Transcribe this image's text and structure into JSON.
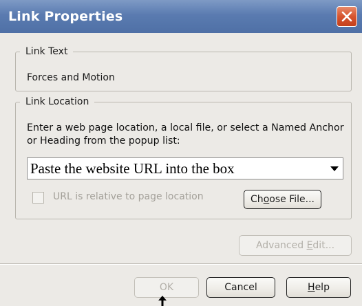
{
  "window": {
    "title": "Link Properties"
  },
  "link_text_group": {
    "legend": "Link Text",
    "value": "Forces and Motion"
  },
  "link_location_group": {
    "legend": "Link Location",
    "instructions": "Enter a web page location, a local file, or select a Named Anchor or Heading from the popup list:",
    "url_value": "Paste the website URL into the box",
    "relative_checkbox_label": "URL is relative to page location",
    "relative_checked": false,
    "choose_file": {
      "pre": "Ch",
      "accel": "o",
      "post": "ose File..."
    }
  },
  "advanced_edit": {
    "pre": "Advanced ",
    "accel": "E",
    "post": "dit..."
  },
  "buttons": {
    "ok": "OK",
    "cancel": "Cancel",
    "help": {
      "accel": "H",
      "post": "elp"
    }
  },
  "colors": {
    "titlebar": "#5a7bb0",
    "close": "#d6542f",
    "dialog_bg": "#eceae6"
  },
  "icons": {
    "close": "close-icon",
    "dropdown": "chevron-down-icon",
    "annotation": "arrow-up-icon"
  }
}
